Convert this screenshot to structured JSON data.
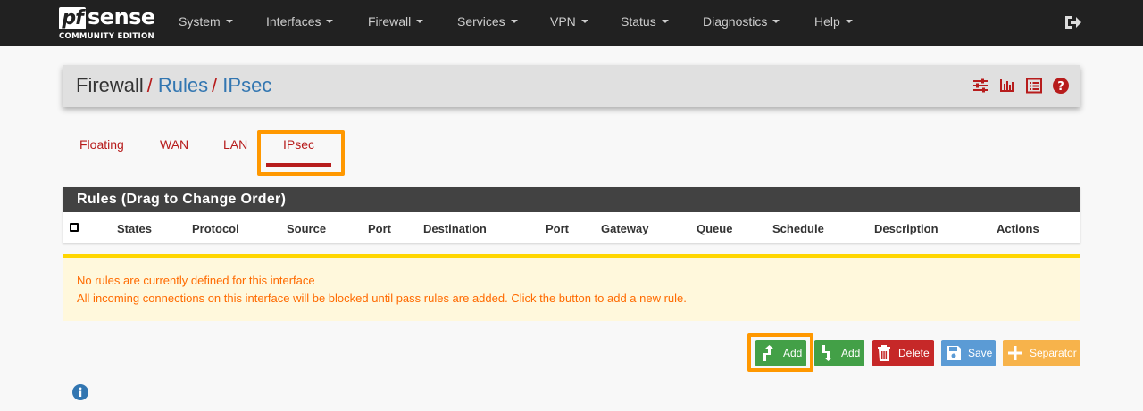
{
  "brand": {
    "logo_pf": "pf",
    "logo_sense": "sense",
    "logo_sub": "COMMUNITY EDITION"
  },
  "nav": {
    "items": [
      {
        "label": "System"
      },
      {
        "label": "Interfaces"
      },
      {
        "label": "Firewall"
      },
      {
        "label": "Services"
      },
      {
        "label": "VPN"
      },
      {
        "label": "Status"
      },
      {
        "label": "Diagnostics"
      },
      {
        "label": "Help"
      }
    ],
    "logout_icon": "sign-out-icon"
  },
  "breadcrumb": {
    "root": "Firewall",
    "sep": "/",
    "level2": "Rules",
    "level3": "IPsec",
    "icons": [
      "sliders-icon",
      "bar-chart-icon",
      "list-icon",
      "help-icon"
    ]
  },
  "tabs": [
    {
      "label": "Floating"
    },
    {
      "label": "WAN"
    },
    {
      "label": "LAN"
    },
    {
      "label": "IPsec",
      "active": true
    }
  ],
  "rules_table": {
    "heading": "Rules (Drag to Change Order)",
    "columns": [
      "States",
      "Protocol",
      "Source",
      "Port",
      "Destination",
      "Port",
      "Gateway",
      "Queue",
      "Schedule",
      "Description",
      "Actions"
    ]
  },
  "warning": {
    "line1": "No rules are currently defined for this interface",
    "line2": "All incoming connections on this interface will be blocked until pass rules are added. Click the button to add a new rule."
  },
  "buttons": {
    "add_top": "Add",
    "add_bottom": "Add",
    "delete": "Delete",
    "save": "Save",
    "separator": "Separator"
  },
  "colors": {
    "navbar": "#212121",
    "accent_red": "#b71c1c",
    "link_blue": "#3276b1",
    "highlight": "#ff9800",
    "btn_green": "#43a047",
    "btn_red": "#c62828",
    "btn_blue": "#5b9bd5",
    "btn_orange": "#f7b34b",
    "warning_text": "#ff6a00"
  }
}
